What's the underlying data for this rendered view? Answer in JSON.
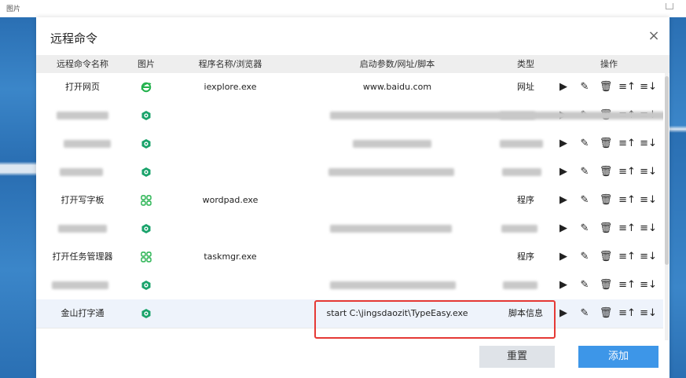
{
  "window": {
    "title": "图片"
  },
  "dialog": {
    "title": "远程命令",
    "close": "×"
  },
  "columns": [
    "远程命令名称",
    "图片",
    "程序名称/浏览器",
    "启动参数/网址/脚本",
    "类型",
    "操作"
  ],
  "rows": [
    {
      "name": "打开网页",
      "icon": "ie-icon",
      "program": "iexplore.exe",
      "param": "www.baidu.com",
      "type": "网址",
      "blurred": false
    },
    {
      "name": "",
      "icon": "hex-icon",
      "program": "",
      "param": "",
      "type": "",
      "blurred": true
    },
    {
      "name": "",
      "icon": "hex-icon",
      "program": "",
      "param": "",
      "type": "",
      "blurred": true
    },
    {
      "name": "",
      "icon": "hex-icon",
      "program": "",
      "param": "",
      "type": "",
      "blurred": true
    },
    {
      "name": "打开写字板",
      "icon": "grid-icon",
      "program": "wordpad.exe",
      "param": "",
      "type": "程序",
      "blurred": false
    },
    {
      "name": "",
      "icon": "hex-icon",
      "program": "",
      "param": "",
      "type": "",
      "blurred": true
    },
    {
      "name": "打开任务管理器",
      "icon": "grid-icon",
      "program": "taskmgr.exe",
      "param": "",
      "type": "程序",
      "blurred": false
    },
    {
      "name": "",
      "icon": "hex-icon",
      "program": "",
      "param": "",
      "type": "",
      "blurred": true
    },
    {
      "name": "金山打字通",
      "icon": "hex-icon",
      "program": "",
      "param": "start C:\\jingsdaozit\\TypeEasy.exe",
      "type": "脚本信息",
      "blurred": false
    }
  ],
  "actions": {
    "run": "▶",
    "edit": "✎",
    "delete": "🗑",
    "up": "≡↑",
    "down": "≡↓"
  },
  "buttons": {
    "reset": "重置",
    "add": "添加"
  },
  "colors": {
    "accent": "#3d96e8",
    "ie": "#22b14c",
    "hex": "#1aa36b",
    "highlight": "#e53935"
  }
}
